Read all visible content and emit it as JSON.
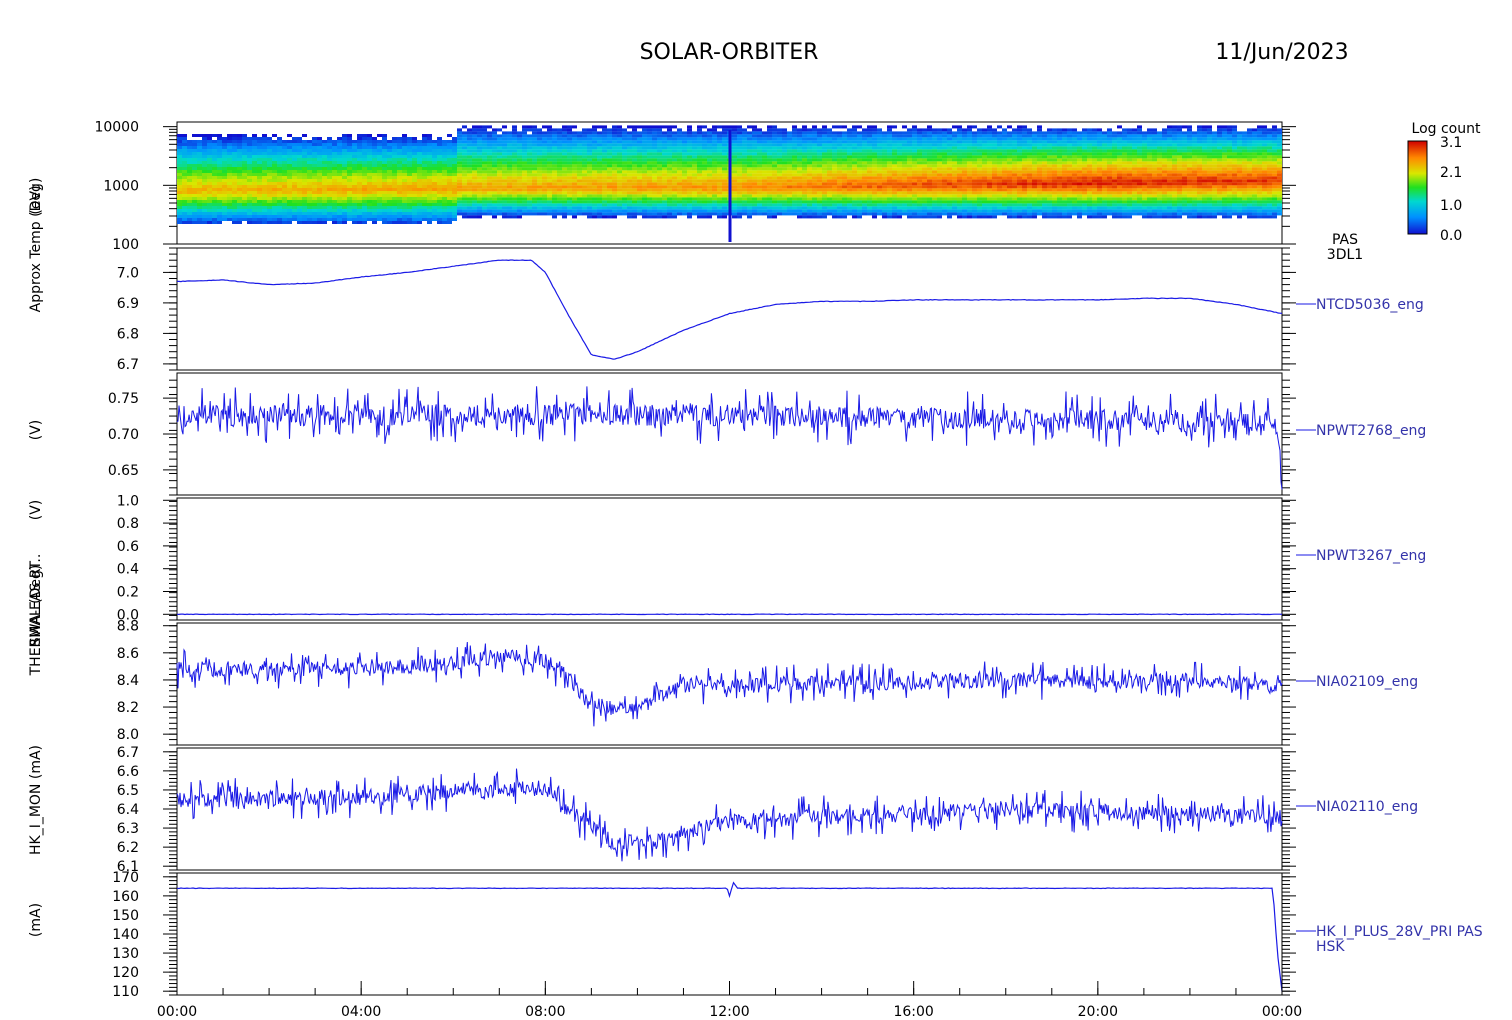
{
  "header": {
    "mission": "SOLAR-ORBITER",
    "date": "11/Jun/2023"
  },
  "colorbar": {
    "title": "Log count",
    "ticks": [
      "3.1",
      "2.1",
      "1.0",
      "0.0"
    ],
    "values": [
      3.1,
      2.1,
      1.0,
      0.0
    ]
  },
  "y_axis_labels_overlaid": [
    "(eV)",
    "Approx Temp (Deg)",
    "(V)",
    "(V)",
    "SWA-EAS RT..",
    "THERMAL (Deg)",
    "HK_I_MON (mA)",
    "(mA)"
  ],
  "x_axis": {
    "tick_labels": [
      "00:00",
      "04:00",
      "08:00",
      "12:00",
      "16:00",
      "20:00",
      "00:00"
    ],
    "hours": [
      0,
      4,
      8,
      12,
      16,
      20,
      24
    ]
  },
  "chart_data": [
    {
      "type": "heatmap",
      "id": "pas-spectrogram",
      "right_label": [
        "PAS",
        "3DL1"
      ],
      "ylabel": "(eV)",
      "yscale": "log",
      "ylim": [
        100,
        12000
      ],
      "tick_labels": [
        "10000",
        "1000",
        "100"
      ],
      "tick_values": [
        10000,
        1000,
        100
      ],
      "color_range": [
        0.0,
        3.1
      ],
      "peak_energy_eV_by_hour": [
        [
          0,
          850
        ],
        [
          4,
          900
        ],
        [
          8,
          950
        ],
        [
          12,
          950
        ],
        [
          16,
          1050
        ],
        [
          20,
          1150
        ],
        [
          24,
          1250
        ]
      ],
      "upper_edge_eV_by_hour": [
        [
          0,
          7500
        ],
        [
          6,
          7500
        ],
        [
          6.01,
          10500
        ],
        [
          24,
          10500
        ]
      ],
      "lower_edge_eV_by_hour": [
        [
          0,
          220
        ],
        [
          6,
          220
        ],
        [
          6.01,
          300
        ],
        [
          24,
          280
        ]
      ],
      "peak_log_count_by_hour": [
        [
          0,
          2.3
        ],
        [
          12,
          2.5
        ],
        [
          16,
          2.8
        ],
        [
          20,
          3.0
        ],
        [
          24,
          2.9
        ]
      ]
    },
    {
      "type": "line",
      "id": "ntcd5036",
      "series_name": "NTCD5036_eng",
      "ylabel": "Approx Temp (Deg)",
      "ylim": [
        6.68,
        7.08
      ],
      "tick_labels": [
        "7.0",
        "6.9",
        "6.8",
        "6.7"
      ],
      "tick_values": [
        7.0,
        6.9,
        6.8,
        6.7
      ],
      "points": [
        [
          0,
          6.97
        ],
        [
          1,
          6.975
        ],
        [
          2,
          6.96
        ],
        [
          3,
          6.965
        ],
        [
          4,
          6.985
        ],
        [
          5,
          7.0
        ],
        [
          6,
          7.02
        ],
        [
          7,
          7.04
        ],
        [
          7.7,
          7.04
        ],
        [
          8,
          7.0
        ],
        [
          8.5,
          6.86
        ],
        [
          9,
          6.73
        ],
        [
          9.5,
          6.715
        ],
        [
          10,
          6.74
        ],
        [
          11,
          6.81
        ],
        [
          12,
          6.865
        ],
        [
          13,
          6.895
        ],
        [
          14,
          6.905
        ],
        [
          15,
          6.905
        ],
        [
          16,
          6.91
        ],
        [
          17,
          6.91
        ],
        [
          18,
          6.91
        ],
        [
          19,
          6.91
        ],
        [
          20,
          6.91
        ],
        [
          21,
          6.915
        ],
        [
          22,
          6.915
        ],
        [
          23,
          6.895
        ],
        [
          24,
          6.865
        ]
      ]
    },
    {
      "type": "line",
      "id": "npwt2768",
      "series_name": "NPWT2768_eng",
      "ylabel": "(V)",
      "ylim": [
        0.615,
        0.785
      ],
      "tick_labels": [
        "0.75",
        "0.70",
        "0.65"
      ],
      "tick_values": [
        0.75,
        0.7,
        0.65
      ],
      "points": [
        [
          0,
          0.725
        ],
        [
          4,
          0.726
        ],
        [
          8,
          0.727
        ],
        [
          12,
          0.726
        ],
        [
          16,
          0.722
        ],
        [
          20,
          0.719
        ],
        [
          23.9,
          0.715
        ],
        [
          24,
          0.625
        ]
      ],
      "noise_amplitude": 0.025
    },
    {
      "type": "line",
      "id": "npwt3267",
      "series_name": "NPWT3267_eng",
      "ylabel": "(V)",
      "ylim": [
        -0.05,
        1.02
      ],
      "tick_labels": [
        "1.0",
        "0.8",
        "0.6",
        "0.4",
        "0.2",
        "0.0"
      ],
      "tick_values": [
        1.0,
        0.8,
        0.6,
        0.4,
        0.2,
        0.0
      ],
      "points": [
        [
          0,
          0.0
        ],
        [
          24,
          0.0
        ]
      ]
    },
    {
      "type": "line",
      "id": "nia02109",
      "series_name": "NIA02109_eng",
      "ylabel": "THERMAL (Deg)",
      "ylim": [
        7.92,
        8.82
      ],
      "tick_labels": [
        "8.8",
        "8.6",
        "8.4",
        "8.2",
        "8.0"
      ],
      "tick_values": [
        8.8,
        8.6,
        8.4,
        8.2,
        8.0
      ],
      "points": [
        [
          0,
          8.48
        ],
        [
          4,
          8.48
        ],
        [
          6,
          8.52
        ],
        [
          7,
          8.58
        ],
        [
          8,
          8.55
        ],
        [
          8.5,
          8.42
        ],
        [
          9,
          8.2
        ],
        [
          10,
          8.18
        ],
        [
          10.5,
          8.28
        ],
        [
          11,
          8.36
        ],
        [
          12,
          8.35
        ],
        [
          14,
          8.38
        ],
        [
          16,
          8.38
        ],
        [
          18,
          8.4
        ],
        [
          20,
          8.38
        ],
        [
          22,
          8.4
        ],
        [
          24,
          8.36
        ]
      ],
      "noise_amplitude": 0.09
    },
    {
      "type": "line",
      "id": "nia02110",
      "series_name": "NIA02110_eng",
      "ylabel": "HK_I_MON (mA)",
      "ylim": [
        6.08,
        6.72
      ],
      "tick_labels": [
        "6.7",
        "6.6",
        "6.5",
        "6.4",
        "6.3",
        "6.2",
        "6.1"
      ],
      "tick_values": [
        6.7,
        6.6,
        6.5,
        6.4,
        6.3,
        6.2,
        6.1
      ],
      "points": [
        [
          0,
          6.45
        ],
        [
          4,
          6.46
        ],
        [
          5,
          6.47
        ],
        [
          6,
          6.5
        ],
        [
          8,
          6.5
        ],
        [
          8.5,
          6.4
        ],
        [
          9,
          6.3
        ],
        [
          9.5,
          6.22
        ],
        [
          10.5,
          6.23
        ],
        [
          11,
          6.28
        ],
        [
          12,
          6.33
        ],
        [
          14,
          6.36
        ],
        [
          16,
          6.37
        ],
        [
          18,
          6.4
        ],
        [
          20,
          6.38
        ],
        [
          22,
          6.38
        ],
        [
          24,
          6.36
        ]
      ],
      "noise_amplitude": 0.07
    },
    {
      "type": "line",
      "id": "hk-i-plus",
      "series_name": "HK_I_PLUS_28V_PRI PAS",
      "series_name_2": "HSK",
      "ylabel": "(mA)",
      "ylim": [
        108,
        172
      ],
      "tick_labels": [
        "170",
        "160",
        "150",
        "140",
        "130",
        "120",
        "110"
      ],
      "tick_values": [
        170,
        160,
        150,
        140,
        130,
        120,
        110
      ],
      "points": [
        [
          0,
          164
        ],
        [
          11.95,
          164
        ],
        [
          12,
          160
        ],
        [
          12.1,
          168
        ],
        [
          12.15,
          164
        ],
        [
          23.8,
          164
        ],
        [
          23.9,
          130
        ],
        [
          24,
          110
        ]
      ]
    }
  ]
}
